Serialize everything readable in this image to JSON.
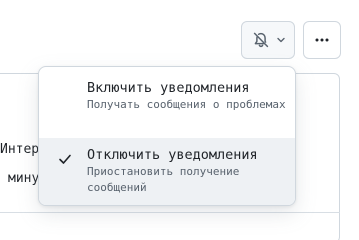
{
  "background": {
    "text_line_1": "Интерв",
    "text_line_2": "мину"
  },
  "header": {
    "notification_button_icon": "bell-slash-icon",
    "dropdown_caret_icon": "chevron-down-icon",
    "more_button_icon": "kebab-horizontal-icon"
  },
  "menu": {
    "items": [
      {
        "title": "Включить уведомления",
        "description": "Получать сообщения о проблемах",
        "selected": false
      },
      {
        "title": "Отключить уведомления",
        "description": "Приостановить получение сообщений",
        "selected": true,
        "icon": "check-icon"
      }
    ]
  },
  "colors": {
    "border": "#d0d7de",
    "selected_bg": "#eef1f4",
    "muted_text": "#59636e"
  }
}
